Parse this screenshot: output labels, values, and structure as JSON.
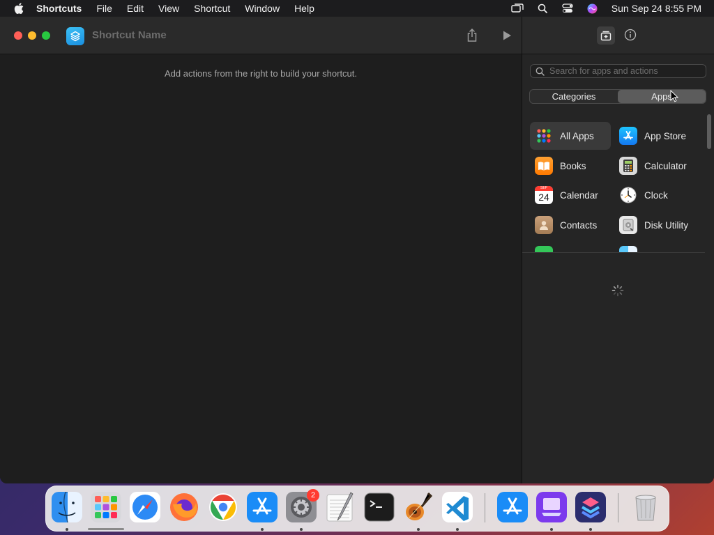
{
  "menubar": {
    "app_name": "Shortcuts",
    "menus": [
      "File",
      "Edit",
      "View",
      "Shortcut",
      "Window",
      "Help"
    ],
    "datetime": "Sun Sep 24  8:55 PM",
    "status_icons": [
      "screen-mirroring-icon",
      "spotlight-icon",
      "control-center-icon",
      "siri-icon"
    ]
  },
  "window": {
    "title_placeholder": "Shortcut Name",
    "empty_hint": "Add actions from the right to build your shortcut."
  },
  "sidebar": {
    "search_placeholder": "Search for apps and actions",
    "segments": [
      "Categories",
      "Apps"
    ],
    "active_segment": "Apps",
    "apps": [
      {
        "label": "All Apps",
        "icon": "all-apps-icon",
        "selected": true
      },
      {
        "label": "App Store",
        "icon": "app-store-icon"
      },
      {
        "label": "Books",
        "icon": "books-icon"
      },
      {
        "label": "Calculator",
        "icon": "calculator-icon"
      },
      {
        "label": "Calendar",
        "icon": "calendar-icon",
        "icon_month": "SEP",
        "icon_day": "24"
      },
      {
        "label": "Clock",
        "icon": "clock-icon"
      },
      {
        "label": "Contacts",
        "icon": "contacts-icon"
      },
      {
        "label": "Disk Utility",
        "icon": "disk-utility-icon"
      }
    ]
  },
  "dock": {
    "apps": [
      {
        "name": "Finder",
        "icon": "finder-icon",
        "running": true
      },
      {
        "name": "Launchpad",
        "icon": "launchpad-icon",
        "running": false
      },
      {
        "name": "Safari",
        "icon": "safari-icon",
        "running": false
      },
      {
        "name": "Firefox",
        "icon": "firefox-icon",
        "running": false
      },
      {
        "name": "Chrome",
        "icon": "chrome-icon",
        "running": false
      },
      {
        "name": "App Store",
        "icon": "app-store-icon",
        "running": true
      },
      {
        "name": "System Settings",
        "icon": "system-settings-icon",
        "running": true,
        "badge": "2"
      },
      {
        "name": "TextEdit",
        "icon": "textedit-icon",
        "running": false
      },
      {
        "name": "Terminal",
        "icon": "terminal-icon",
        "running": false
      },
      {
        "name": "GarageBand",
        "icon": "garageband-icon",
        "running": true
      },
      {
        "name": "Visual Studio Code",
        "icon": "vscode-icon",
        "running": true
      },
      {
        "name": "App Store",
        "icon": "app-store-icon",
        "running": false
      },
      {
        "name": "Apple Configurator",
        "icon": "configurator-icon",
        "running": true
      },
      {
        "name": "Shortcuts",
        "icon": "shortcuts-icon",
        "running": true
      },
      {
        "name": "Trash",
        "icon": "trash-icon",
        "running": false
      }
    ]
  }
}
